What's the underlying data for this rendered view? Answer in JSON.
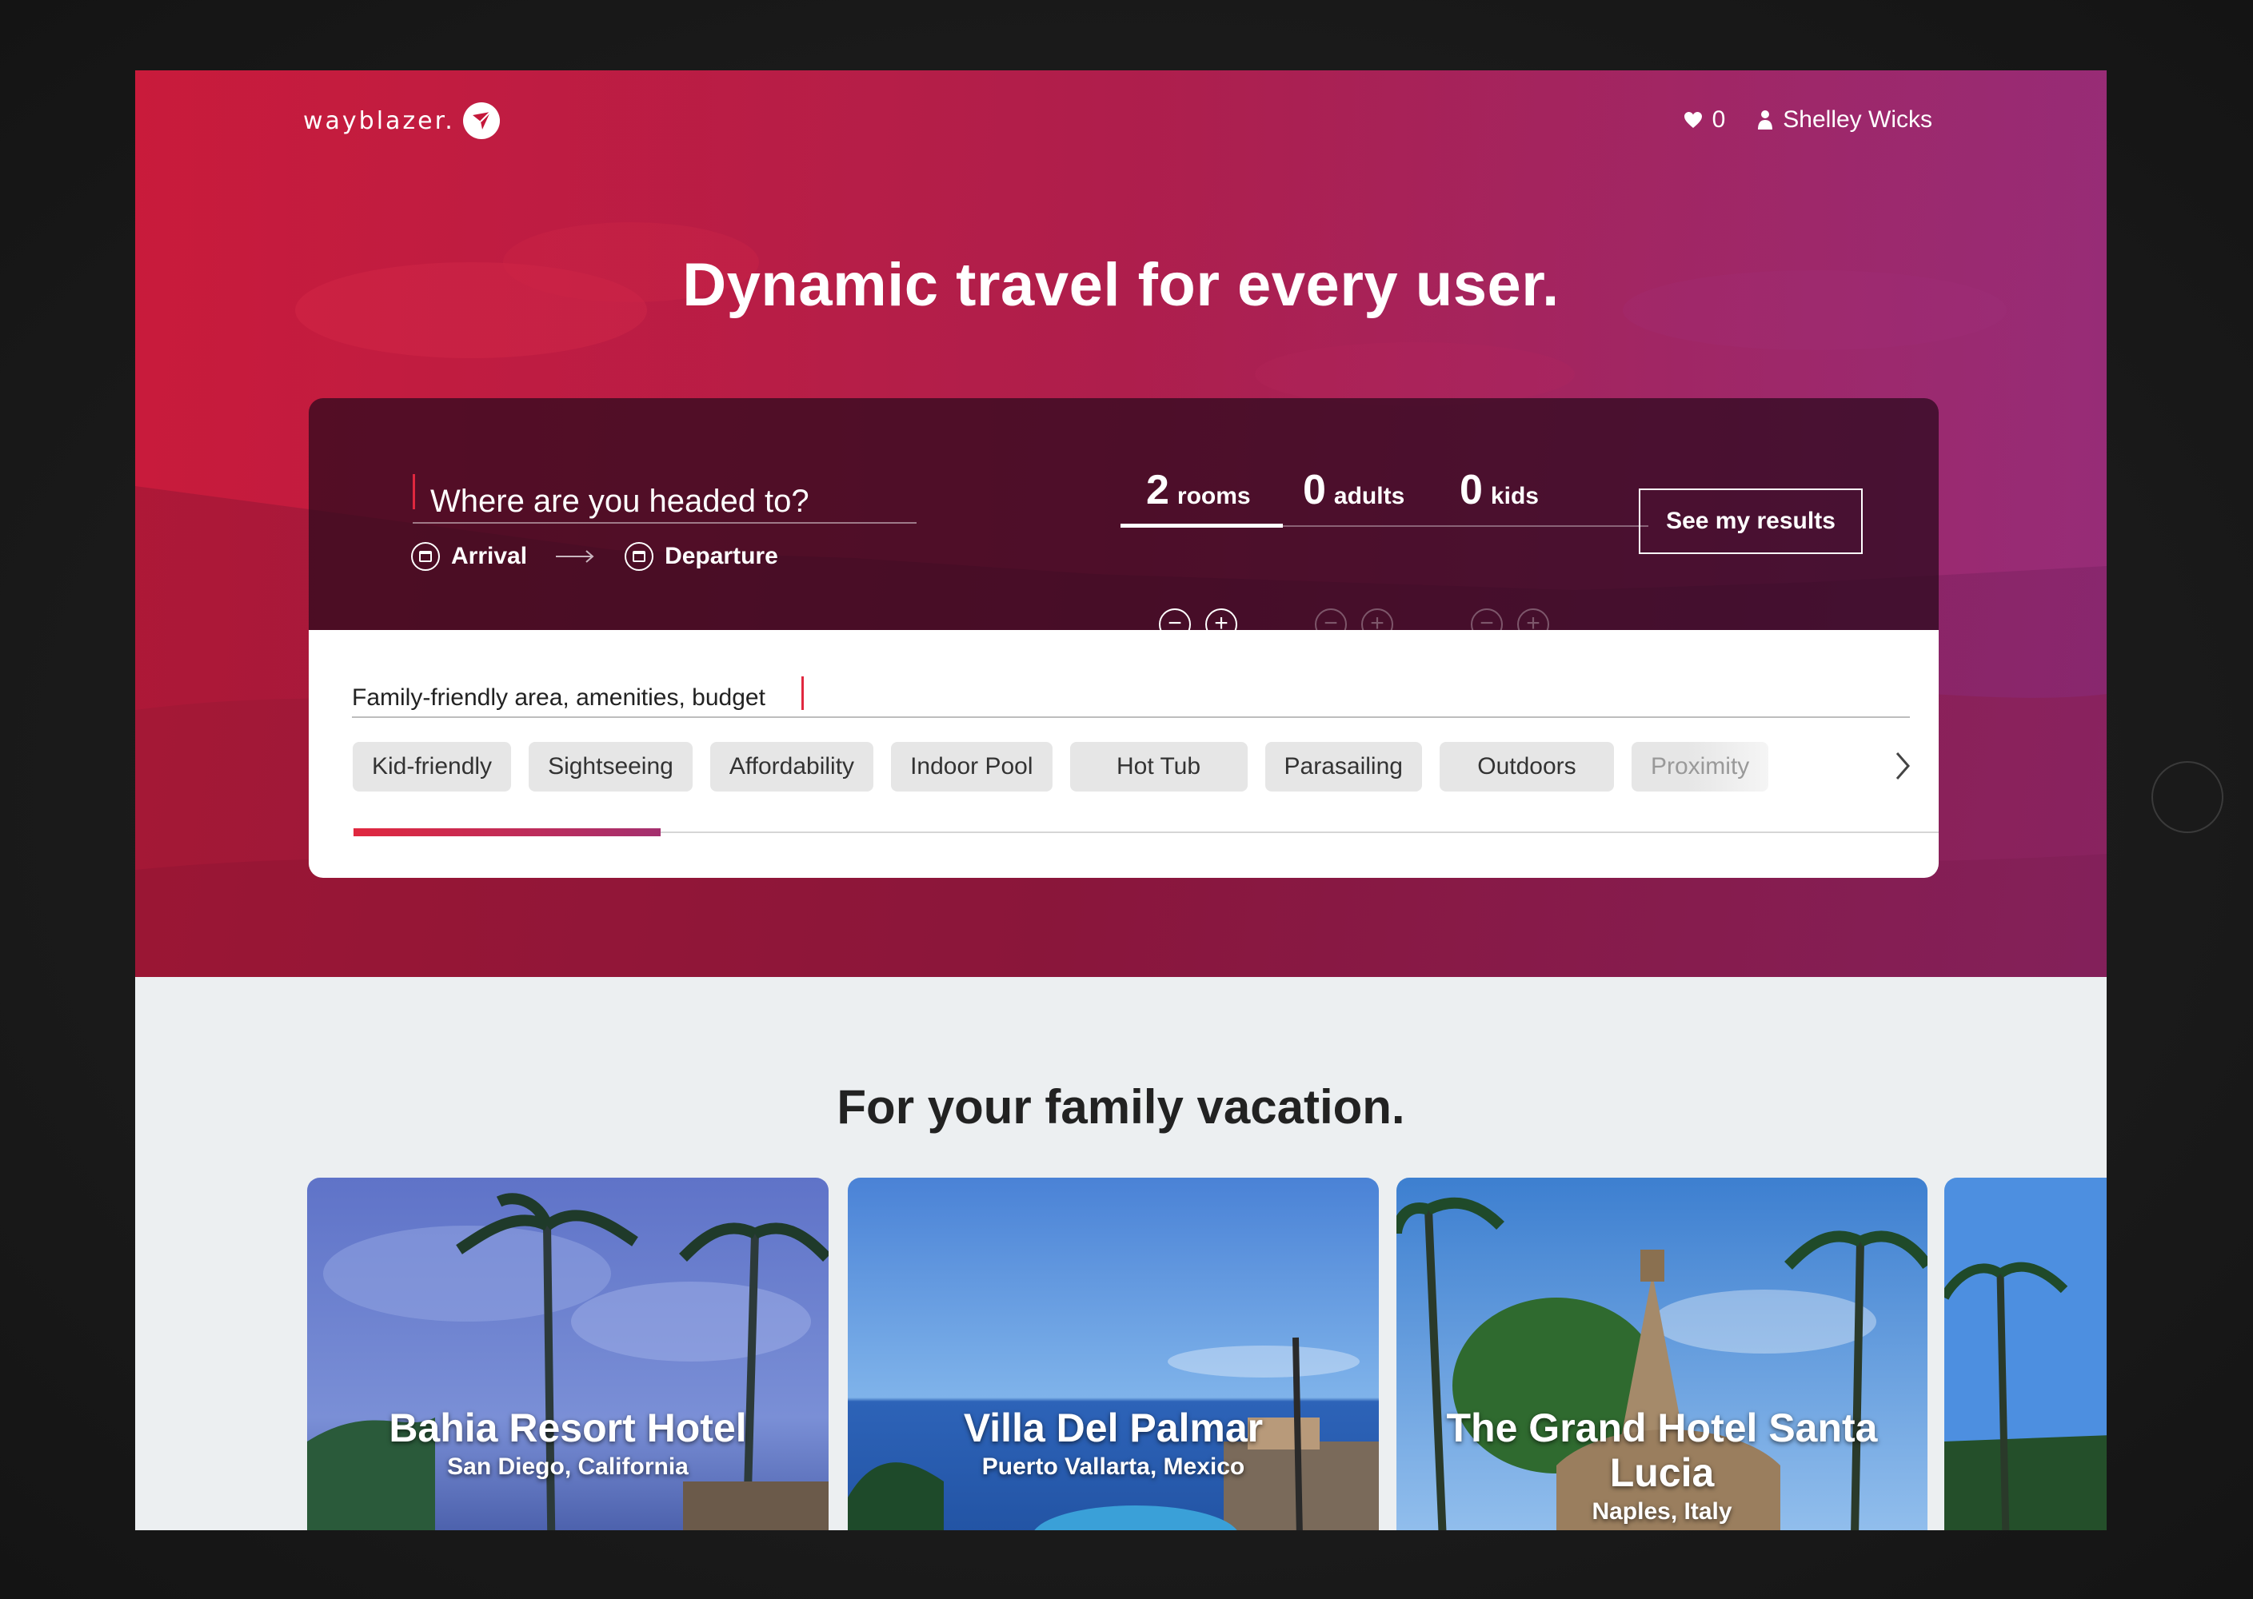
{
  "brand": {
    "name": "wayblazer."
  },
  "nav": {
    "favorites_count": "0",
    "user_name": "Shelley Wicks"
  },
  "hero": {
    "headline": "Dynamic travel for every user."
  },
  "search": {
    "destination_placeholder": "Where are you headed to?",
    "arrival_label": "Arrival",
    "departure_label": "Departure",
    "counters": [
      {
        "value": "2",
        "unit": "rooms"
      },
      {
        "value": "0",
        "unit": "adults"
      },
      {
        "value": "0",
        "unit": "kids"
      }
    ],
    "results_button": "See my results",
    "preferences_text": "Family-friendly area, amenities, budget",
    "chips": [
      "Kid-friendly",
      "Sightseeing",
      "Affordability",
      "Indoor Pool",
      "Hot Tub",
      "Parasailing",
      "Outdoors",
      "Proximity"
    ],
    "progress": 0.11
  },
  "section": {
    "title": "For your family vacation.",
    "hotels": [
      {
        "name": "Bahia Resort Hotel",
        "location": "San Diego, California"
      },
      {
        "name": "Villa Del Palmar",
        "location": "Puerto Vallarta, Mexico"
      },
      {
        "name": "The Grand Hotel Santa Lucia",
        "location": "Naples, Italy"
      }
    ]
  },
  "colors": {
    "accent": "#e0283f",
    "accent_end": "#a4306f",
    "surface": "#eceff1"
  }
}
